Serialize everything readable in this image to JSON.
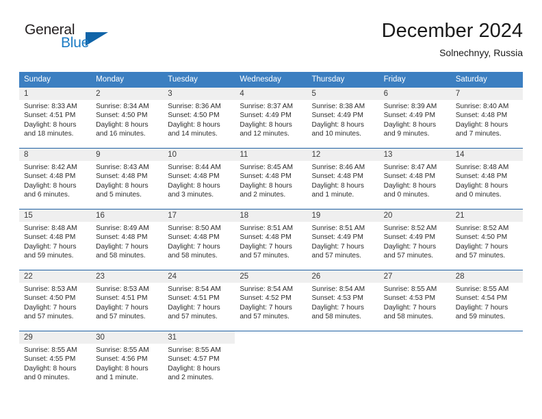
{
  "brand": {
    "word_one": "General",
    "word_two": "Blue",
    "logo_icon": "triangle-logo-icon",
    "primary_color": "#1064a8",
    "accent_color": "#1d7cc4"
  },
  "header": {
    "title": "December 2024",
    "location": "Solnechnyy, Russia"
  },
  "theme": {
    "header_row_bg": "#3c7fc1",
    "week_divider": "#1d5fa2",
    "daynum_band_bg": "#efefef",
    "text_color": "#2b2b2b"
  },
  "weekdays": [
    "Sunday",
    "Monday",
    "Tuesday",
    "Wednesday",
    "Thursday",
    "Friday",
    "Saturday"
  ],
  "labels": {
    "sunrise_prefix": "Sunrise:",
    "sunset_prefix": "Sunset:",
    "daylight_prefix": "Daylight:"
  },
  "weeks": [
    [
      {
        "day": "1",
        "sunrise": "Sunrise: 8:33 AM",
        "sunset": "Sunset: 4:51 PM",
        "daylight": "Daylight: 8 hours and 18 minutes."
      },
      {
        "day": "2",
        "sunrise": "Sunrise: 8:34 AM",
        "sunset": "Sunset: 4:50 PM",
        "daylight": "Daylight: 8 hours and 16 minutes."
      },
      {
        "day": "3",
        "sunrise": "Sunrise: 8:36 AM",
        "sunset": "Sunset: 4:50 PM",
        "daylight": "Daylight: 8 hours and 14 minutes."
      },
      {
        "day": "4",
        "sunrise": "Sunrise: 8:37 AM",
        "sunset": "Sunset: 4:49 PM",
        "daylight": "Daylight: 8 hours and 12 minutes."
      },
      {
        "day": "5",
        "sunrise": "Sunrise: 8:38 AM",
        "sunset": "Sunset: 4:49 PM",
        "daylight": "Daylight: 8 hours and 10 minutes."
      },
      {
        "day": "6",
        "sunrise": "Sunrise: 8:39 AM",
        "sunset": "Sunset: 4:49 PM",
        "daylight": "Daylight: 8 hours and 9 minutes."
      },
      {
        "day": "7",
        "sunrise": "Sunrise: 8:40 AM",
        "sunset": "Sunset: 4:48 PM",
        "daylight": "Daylight: 8 hours and 7 minutes."
      }
    ],
    [
      {
        "day": "8",
        "sunrise": "Sunrise: 8:42 AM",
        "sunset": "Sunset: 4:48 PM",
        "daylight": "Daylight: 8 hours and 6 minutes."
      },
      {
        "day": "9",
        "sunrise": "Sunrise: 8:43 AM",
        "sunset": "Sunset: 4:48 PM",
        "daylight": "Daylight: 8 hours and 5 minutes."
      },
      {
        "day": "10",
        "sunrise": "Sunrise: 8:44 AM",
        "sunset": "Sunset: 4:48 PM",
        "daylight": "Daylight: 8 hours and 3 minutes."
      },
      {
        "day": "11",
        "sunrise": "Sunrise: 8:45 AM",
        "sunset": "Sunset: 4:48 PM",
        "daylight": "Daylight: 8 hours and 2 minutes."
      },
      {
        "day": "12",
        "sunrise": "Sunrise: 8:46 AM",
        "sunset": "Sunset: 4:48 PM",
        "daylight": "Daylight: 8 hours and 1 minute."
      },
      {
        "day": "13",
        "sunrise": "Sunrise: 8:47 AM",
        "sunset": "Sunset: 4:48 PM",
        "daylight": "Daylight: 8 hours and 0 minutes."
      },
      {
        "day": "14",
        "sunrise": "Sunrise: 8:48 AM",
        "sunset": "Sunset: 4:48 PM",
        "daylight": "Daylight: 8 hours and 0 minutes."
      }
    ],
    [
      {
        "day": "15",
        "sunrise": "Sunrise: 8:48 AM",
        "sunset": "Sunset: 4:48 PM",
        "daylight": "Daylight: 7 hours and 59 minutes."
      },
      {
        "day": "16",
        "sunrise": "Sunrise: 8:49 AM",
        "sunset": "Sunset: 4:48 PM",
        "daylight": "Daylight: 7 hours and 58 minutes."
      },
      {
        "day": "17",
        "sunrise": "Sunrise: 8:50 AM",
        "sunset": "Sunset: 4:48 PM",
        "daylight": "Daylight: 7 hours and 58 minutes."
      },
      {
        "day": "18",
        "sunrise": "Sunrise: 8:51 AM",
        "sunset": "Sunset: 4:48 PM",
        "daylight": "Daylight: 7 hours and 57 minutes."
      },
      {
        "day": "19",
        "sunrise": "Sunrise: 8:51 AM",
        "sunset": "Sunset: 4:49 PM",
        "daylight": "Daylight: 7 hours and 57 minutes."
      },
      {
        "day": "20",
        "sunrise": "Sunrise: 8:52 AM",
        "sunset": "Sunset: 4:49 PM",
        "daylight": "Daylight: 7 hours and 57 minutes."
      },
      {
        "day": "21",
        "sunrise": "Sunrise: 8:52 AM",
        "sunset": "Sunset: 4:50 PM",
        "daylight": "Daylight: 7 hours and 57 minutes."
      }
    ],
    [
      {
        "day": "22",
        "sunrise": "Sunrise: 8:53 AM",
        "sunset": "Sunset: 4:50 PM",
        "daylight": "Daylight: 7 hours and 57 minutes."
      },
      {
        "day": "23",
        "sunrise": "Sunrise: 8:53 AM",
        "sunset": "Sunset: 4:51 PM",
        "daylight": "Daylight: 7 hours and 57 minutes."
      },
      {
        "day": "24",
        "sunrise": "Sunrise: 8:54 AM",
        "sunset": "Sunset: 4:51 PM",
        "daylight": "Daylight: 7 hours and 57 minutes."
      },
      {
        "day": "25",
        "sunrise": "Sunrise: 8:54 AM",
        "sunset": "Sunset: 4:52 PM",
        "daylight": "Daylight: 7 hours and 57 minutes."
      },
      {
        "day": "26",
        "sunrise": "Sunrise: 8:54 AM",
        "sunset": "Sunset: 4:53 PM",
        "daylight": "Daylight: 7 hours and 58 minutes."
      },
      {
        "day": "27",
        "sunrise": "Sunrise: 8:55 AM",
        "sunset": "Sunset: 4:53 PM",
        "daylight": "Daylight: 7 hours and 58 minutes."
      },
      {
        "day": "28",
        "sunrise": "Sunrise: 8:55 AM",
        "sunset": "Sunset: 4:54 PM",
        "daylight": "Daylight: 7 hours and 59 minutes."
      }
    ],
    [
      {
        "day": "29",
        "sunrise": "Sunrise: 8:55 AM",
        "sunset": "Sunset: 4:55 PM",
        "daylight": "Daylight: 8 hours and 0 minutes."
      },
      {
        "day": "30",
        "sunrise": "Sunrise: 8:55 AM",
        "sunset": "Sunset: 4:56 PM",
        "daylight": "Daylight: 8 hours and 1 minute."
      },
      {
        "day": "31",
        "sunrise": "Sunrise: 8:55 AM",
        "sunset": "Sunset: 4:57 PM",
        "daylight": "Daylight: 8 hours and 2 minutes."
      },
      {
        "day": "",
        "sunrise": "",
        "sunset": "",
        "daylight": ""
      },
      {
        "day": "",
        "sunrise": "",
        "sunset": "",
        "daylight": ""
      },
      {
        "day": "",
        "sunrise": "",
        "sunset": "",
        "daylight": ""
      },
      {
        "day": "",
        "sunrise": "",
        "sunset": "",
        "daylight": ""
      }
    ]
  ]
}
